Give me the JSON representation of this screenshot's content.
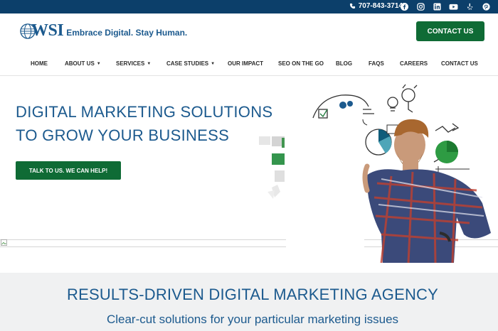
{
  "topbar": {
    "phone": "707-843-3714",
    "social_icons": [
      "facebook-icon",
      "instagram-icon",
      "linkedin-icon",
      "youtube-icon",
      "yelp-icon",
      "pinterest-icon"
    ]
  },
  "header": {
    "logo_text": "WSI",
    "tagline": "Embrace Digital. Stay Human.",
    "cta_label": "CONTACT US"
  },
  "nav": {
    "items": [
      {
        "label": "HOME"
      },
      {
        "label": "ABOUT US"
      },
      {
        "label": "SERVICES"
      },
      {
        "label": "CASE STUDIES"
      },
      {
        "label": "OUR IMPACT"
      },
      {
        "label": "SEO ON THE GO"
      },
      {
        "label": "BLOG"
      },
      {
        "label": "FAQS"
      },
      {
        "label": "CAREERS"
      },
      {
        "label": "CONTACT US"
      }
    ]
  },
  "hero": {
    "title_line1": "DIGITAL MARKETING SOLUTIONS",
    "title_line2": "TO GROW YOUR BUSINESS",
    "button_label": "TALK TO US. WE CAN HELP!"
  },
  "results": {
    "title": "RESULTS-DRIVEN DIGITAL MARKETING AGENCY",
    "subtitle": "Clear-cut solutions for your particular marketing issues"
  },
  "colors": {
    "topbar": "#0c3f6a",
    "brand_blue": "#1c5a8e",
    "brand_green": "#0f6b35",
    "band": "#f0f1f2"
  }
}
